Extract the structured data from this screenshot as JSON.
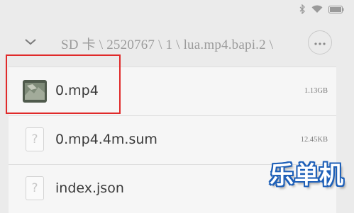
{
  "statusbar": {
    "icons": [
      "bluetooth-icon",
      "wifi-icon",
      "battery-icon"
    ]
  },
  "pathbar": {
    "path": "SD 卡 \\ 2520767 \\ 1 \\ lua.mp4.bapi.2 \\",
    "more_label": "···"
  },
  "files": [
    {
      "name": "0.mp4",
      "size": "1.13GB",
      "icon": "video-thumbnail"
    },
    {
      "name": "0.mp4.4m.sum",
      "size": "12.45KB",
      "icon": "unknown-file-icon",
      "glyph": "?"
    },
    {
      "name": "index.json",
      "size": "",
      "icon": "unknown-file-icon",
      "glyph": "?"
    }
  ],
  "watermark": "乐单机",
  "colors": {
    "background": "#ebebeb",
    "row": "#f6f6f6",
    "highlight": "#e02a2a",
    "watermark_outline": "#1d5fb8"
  }
}
